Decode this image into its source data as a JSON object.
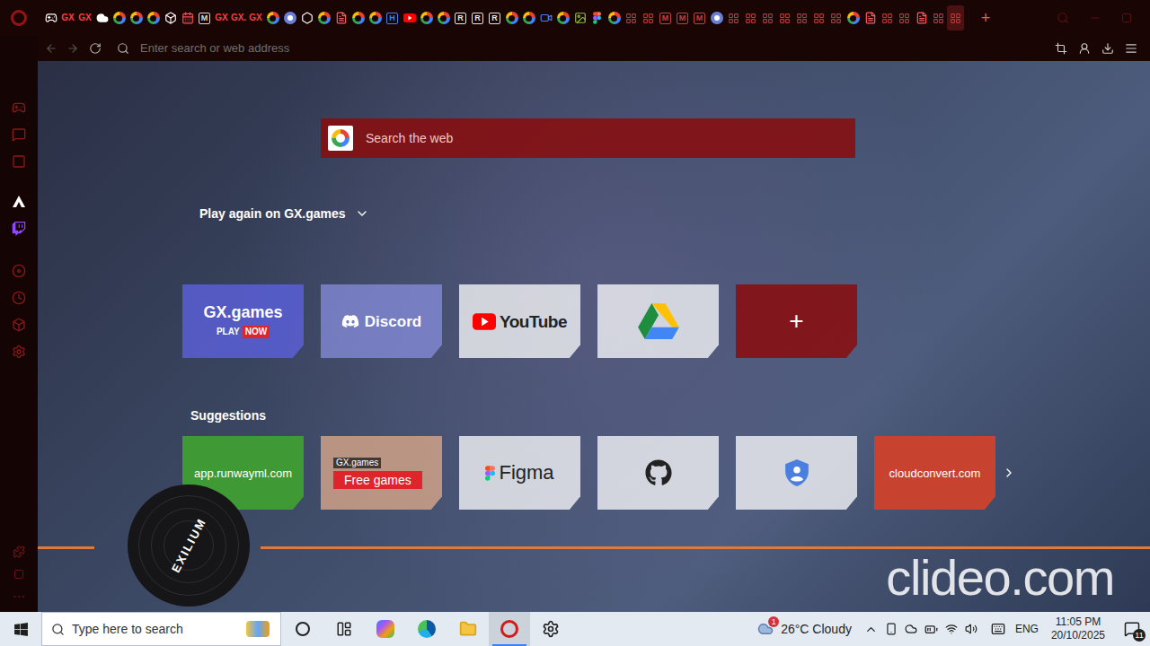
{
  "browser": {
    "tabs": [
      {
        "kind": "controller",
        "selected": false
      },
      {
        "kind": "gx",
        "label": "GX",
        "selected": false
      },
      {
        "kind": "gx",
        "label": "GX",
        "selected": false
      },
      {
        "kind": "cloud",
        "selected": false
      },
      {
        "kind": "google",
        "selected": false
      },
      {
        "kind": "google",
        "selected": false
      },
      {
        "kind": "google",
        "selected": false
      },
      {
        "kind": "cube",
        "selected": false
      },
      {
        "kind": "calendar",
        "selected": false
      },
      {
        "kind": "letter",
        "label": "M",
        "color": "#d9d9d9",
        "selected": false
      },
      {
        "kind": "gx",
        "label": "GX",
        "selected": false
      },
      {
        "kind": "gx",
        "label": "GX.",
        "selected": false
      },
      {
        "kind": "gx",
        "label": "GX",
        "selected": false
      },
      {
        "kind": "google",
        "selected": false
      },
      {
        "kind": "chrome",
        "selected": false
      },
      {
        "kind": "hex",
        "selected": false
      },
      {
        "kind": "google",
        "selected": false
      },
      {
        "kind": "pdf",
        "selected": false
      },
      {
        "kind": "google",
        "selected": false
      },
      {
        "kind": "google",
        "selected": false
      },
      {
        "kind": "letter",
        "label": "H",
        "color": "#3b82f6",
        "selected": false
      },
      {
        "kind": "youtube",
        "selected": false
      },
      {
        "kind": "google",
        "selected": false
      },
      {
        "kind": "google",
        "selected": false
      },
      {
        "kind": "letter",
        "label": "R",
        "color": "#e5e5e5",
        "selected": false
      },
      {
        "kind": "letter",
        "label": "R",
        "color": "#e5e5e5",
        "selected": false
      },
      {
        "kind": "letter",
        "label": "R",
        "color": "#e5e5e5",
        "selected": false
      },
      {
        "kind": "google",
        "selected": false
      },
      {
        "kind": "google",
        "selected": false
      },
      {
        "kind": "video",
        "selected": false
      },
      {
        "kind": "google",
        "selected": false
      },
      {
        "kind": "image",
        "selected": false
      },
      {
        "kind": "figma",
        "selected": false
      },
      {
        "kind": "google",
        "selected": false
      },
      {
        "kind": "grid",
        "selected": false
      },
      {
        "kind": "grid",
        "selected": false
      },
      {
        "kind": "letter",
        "label": "M",
        "color": "#c04040",
        "selected": false
      },
      {
        "kind": "letter",
        "label": "M",
        "color": "#c04040",
        "selected": false
      },
      {
        "kind": "letter",
        "label": "M",
        "color": "#c04040",
        "selected": false
      },
      {
        "kind": "chrome",
        "selected": false
      },
      {
        "kind": "grid",
        "selected": false
      },
      {
        "kind": "grid",
        "selected": false
      },
      {
        "kind": "grid",
        "selected": false
      },
      {
        "kind": "grid",
        "selected": false
      },
      {
        "kind": "grid",
        "selected": false
      },
      {
        "kind": "grid",
        "selected": false
      },
      {
        "kind": "grid",
        "selected": false
      },
      {
        "kind": "google",
        "selected": false
      },
      {
        "kind": "pdf",
        "selected": false
      },
      {
        "kind": "grid",
        "selected": false
      },
      {
        "kind": "grid",
        "selected": false
      },
      {
        "kind": "pdf",
        "selected": false
      },
      {
        "kind": "grid",
        "selected": false
      },
      {
        "kind": "grid",
        "selected": true
      }
    ],
    "new_tab": "+",
    "address_bar": {
      "placeholder": "Enter search or web address"
    },
    "sidebar_more": "⋯"
  },
  "start_page": {
    "search": {
      "placeholder": "Search the web"
    },
    "play_again": "Play again on GX.games",
    "speed_dial": [
      {
        "kind": "gx",
        "title": "GX.games",
        "caption": "PLAY",
        "badge": "NOW"
      },
      {
        "kind": "discord",
        "title": "Discord"
      },
      {
        "kind": "youtube",
        "title": "YouTube"
      },
      {
        "kind": "drive"
      },
      {
        "kind": "add",
        "title": "+"
      }
    ],
    "suggestions": {
      "title": "Suggestions",
      "items": [
        {
          "kind": "site",
          "title": "app.runwayml.com",
          "color": "#3f9a35"
        },
        {
          "kind": "gx_free",
          "title": "GX.games",
          "button": "Free games"
        },
        {
          "kind": "figma",
          "title": "Figma"
        },
        {
          "kind": "github"
        },
        {
          "kind": "account"
        },
        {
          "kind": "site",
          "title": "cloudconvert.com",
          "color": "#c8432f"
        }
      ]
    },
    "player": {
      "label": "EXILIUM"
    }
  },
  "watermark": "clideo.com",
  "taskbar": {
    "search_placeholder": "Type here to search",
    "apps": [
      {
        "kind": "cortana",
        "active": false
      },
      {
        "kind": "task_view",
        "active": false
      },
      {
        "kind": "copilot",
        "active": false
      },
      {
        "kind": "edge",
        "active": false
      },
      {
        "kind": "explorer",
        "active": false
      },
      {
        "kind": "opera",
        "active": true
      },
      {
        "kind": "settings",
        "active": false
      }
    ],
    "weather": {
      "text": "26°C Cloudy",
      "badge": "1"
    },
    "language": "ENG",
    "time": "11:05 PM",
    "date": "20/10/2025",
    "notifications": "11"
  }
}
